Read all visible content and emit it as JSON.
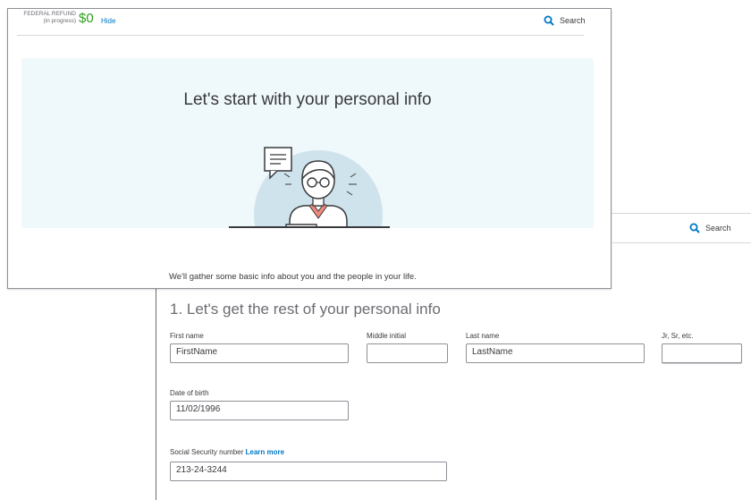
{
  "back": {
    "search_label": "Search",
    "section_title": "1. Let's get the rest of your personal info",
    "fields": {
      "first_name_label": "First name",
      "first_name_value": "FirstName",
      "middle_initial_label": "Middle initial",
      "middle_initial_value": "",
      "last_name_label": "Last name",
      "last_name_value": "LastName",
      "suffix_label": "Jr, Sr, etc.",
      "suffix_value": "",
      "dob_label": "Date of birth",
      "dob_value": "11/02/1996",
      "ssn_label": "Social Security number",
      "ssn_learn_more": "Learn more",
      "ssn_value": "213-24-3244"
    }
  },
  "front": {
    "refund_label_line1": "FEDERAL REFUND",
    "refund_label_line2": "(in progress)",
    "refund_amount": "$0",
    "hide_label": "Hide",
    "search_label": "Search",
    "hero_title": "Let's start with your personal info",
    "sub_text": "We'll gather some basic info about you and the people in your life."
  },
  "colors": {
    "accent_green": "#2ca01c",
    "link_blue": "#0077c5",
    "hero_bg": "#eff8fa",
    "illustration_circle": "#cfe3ec",
    "illustration_coral": "#f08a7b",
    "illustration_teal": "#52d1a3"
  },
  "icons": [
    "search-icon",
    "person-illustration"
  ]
}
